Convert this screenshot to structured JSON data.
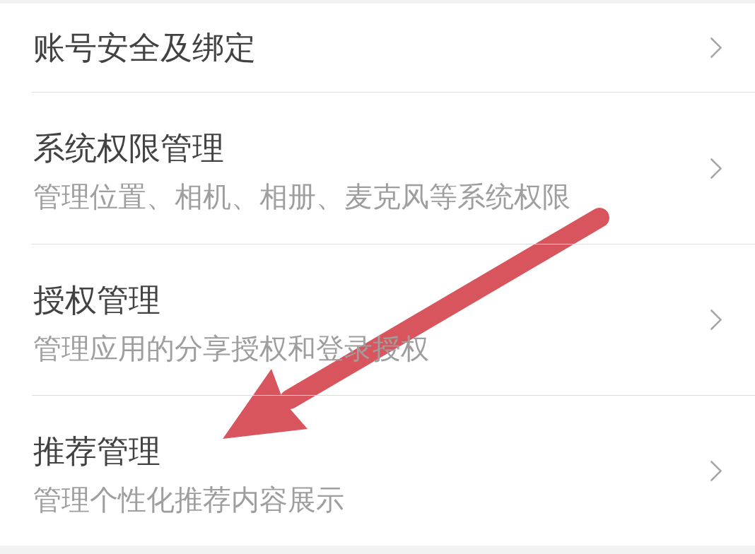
{
  "settings_list": [
    {
      "title": "账号安全及绑定"
    },
    {
      "title": "系统权限管理",
      "subtitle": "管理位置、相机、相册、麦克风等系统权限"
    },
    {
      "title": "授权管理",
      "subtitle": "管理应用的分享授权和登录授权"
    },
    {
      "title": "推荐管理",
      "subtitle": "管理个性化推荐内容展示"
    }
  ]
}
